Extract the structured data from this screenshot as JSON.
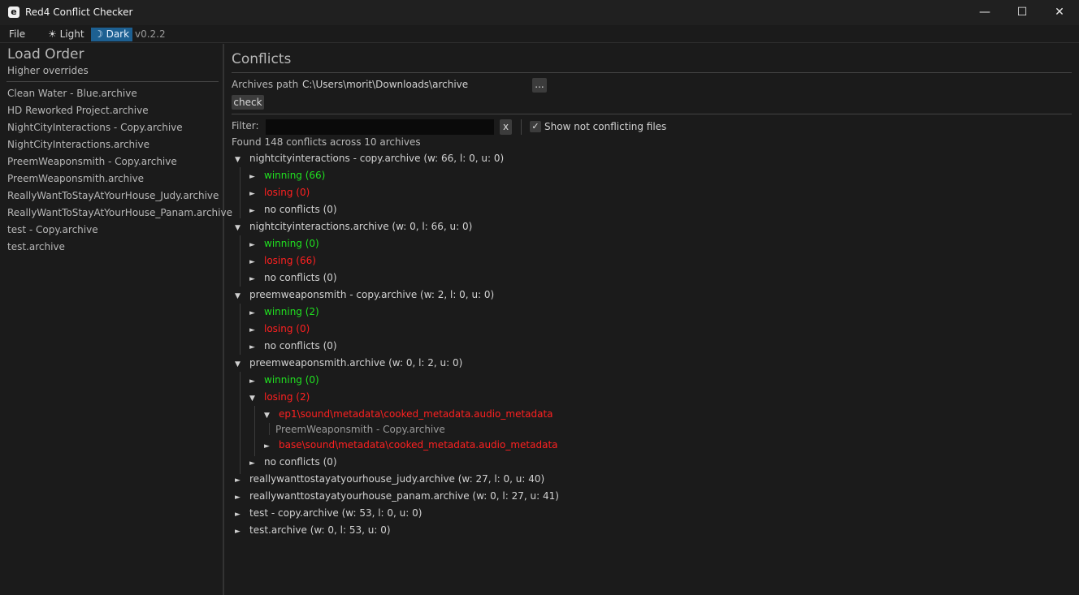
{
  "window": {
    "title": "Red4 Conflict Checker",
    "icon": "e",
    "minimize": "—",
    "maximize": "☐",
    "close": "✕"
  },
  "menubar": {
    "file": "File",
    "light": "☀ Light",
    "dark": "☽ Dark",
    "version": "v0.2.2",
    "theme_selected": "dark"
  },
  "load_order": {
    "title": "Load Order",
    "subtitle": "Higher overrides",
    "items": [
      "Clean Water - Blue.archive",
      "HD Reworked Project.archive",
      "NightCityInteractions - Copy.archive",
      "NightCityInteractions.archive",
      "PreemWeaponsmith - Copy.archive",
      "PreemWeaponsmith.archive",
      "ReallyWantToStayAtYourHouse_Judy.archive",
      "ReallyWantToStayAtYourHouse_Panam.archive",
      "test - Copy.archive",
      "test.archive"
    ]
  },
  "conflicts": {
    "title": "Conflicts",
    "archives_path_label": "Archives path",
    "archives_path_value": "C:\\Users\\morit\\Downloads\\archive",
    "browse_label": "...",
    "check_label": "check",
    "filter_label": "Filter:",
    "filter_value": "",
    "clear_label": "x",
    "show_not_conflicting_label": "Show not conflicting files",
    "show_not_conflicting_checked": true,
    "summary": "Found 148 conflicts across 10 archives",
    "archives": [
      {
        "label": "nightcityinteractions - copy.archive (w: 66, l: 0, u: 0)",
        "expanded": true,
        "winning": "winning (66)",
        "losing": "losing (0)",
        "noconf": "no conflicts (0)"
      },
      {
        "label": "nightcityinteractions.archive (w: 0, l: 66, u: 0)",
        "expanded": true,
        "winning": "winning (0)",
        "losing": "losing (66)",
        "noconf": "no conflicts (0)"
      },
      {
        "label": "preemweaponsmith - copy.archive (w: 2, l: 0, u: 0)",
        "expanded": true,
        "winning": "winning (2)",
        "losing": "losing (0)",
        "noconf": "no conflicts (0)"
      },
      {
        "label": "preemweaponsmith.archive (w: 0, l: 2, u: 0)",
        "expanded": true,
        "winning": "winning (0)",
        "losing": "losing (2)",
        "noconf": "no conflicts (0)",
        "losing_files": [
          {
            "path": "ep1\\sound\\metadata\\cooked_metadata.audio_metadata",
            "expanded": true,
            "winner": "PreemWeaponsmith - Copy.archive"
          },
          {
            "path": "base\\sound\\metadata\\cooked_metadata.audio_metadata",
            "expanded": false
          }
        ]
      },
      {
        "label": "reallywanttostayatyourhouse_judy.archive (w: 27, l: 0, u: 40)",
        "expanded": false
      },
      {
        "label": "reallywanttostayatyourhouse_panam.archive (w: 0, l: 27, u: 41)",
        "expanded": false
      },
      {
        "label": "test - copy.archive (w: 53, l: 0, u: 0)",
        "expanded": false
      },
      {
        "label": "test.archive (w: 0, l: 53, u: 0)",
        "expanded": false
      }
    ]
  },
  "icons": {
    "expanded": "▼",
    "collapsed": "►",
    "check": "✓"
  }
}
